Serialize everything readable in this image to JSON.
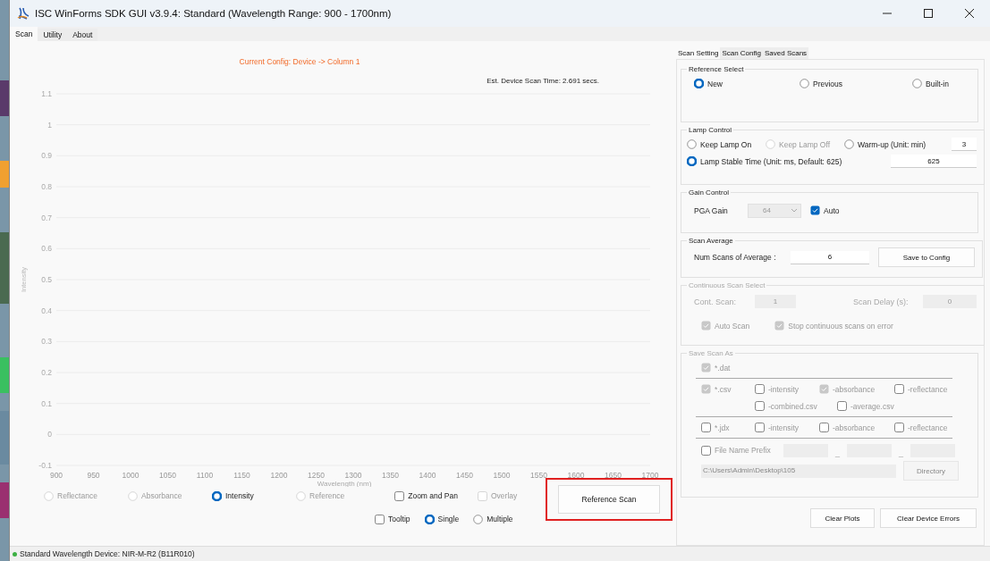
{
  "window": {
    "title": "ISC WinForms SDK GUI v3.9.4: Standard (Wavelength Range: 900 - 1700nm)"
  },
  "tabs": [
    {
      "label": "Scan",
      "selected": true
    },
    {
      "label": "Utility",
      "selected": false
    },
    {
      "label": "About",
      "selected": false
    }
  ],
  "plot": {
    "config_text": "Current Config: Device -> Column 1",
    "scan_time": "Est. Device Scan Time: 2.691 secs.",
    "chart_data": {
      "type": "line",
      "grid": true,
      "xlabel": "Wavelength (nm)",
      "ylabel": "Intensity",
      "xlim": [
        900,
        1700
      ],
      "ylim": [
        -0.1,
        1.1
      ],
      "xticks": [
        900,
        950,
        1000,
        1050,
        1100,
        1150,
        1200,
        1250,
        1300,
        1350,
        1400,
        1450,
        1500,
        1550,
        1600,
        1650,
        1700
      ],
      "yticks": [
        -0.1,
        0,
        0.1,
        0.2,
        0.3,
        0.4,
        0.5,
        0.6,
        0.7,
        0.8,
        0.9,
        1,
        1.1
      ]
    }
  },
  "plot_modes": [
    {
      "label": "Reflectance",
      "selected": false,
      "disabled": true
    },
    {
      "label": "Absorbance",
      "selected": false,
      "disabled": true
    },
    {
      "label": "Intensity",
      "selected": true,
      "disabled": false
    },
    {
      "label": "Reference",
      "selected": false,
      "disabled": true
    }
  ],
  "plot_options": [
    {
      "kind": "checkbox",
      "label": "Zoom and Pan",
      "checked": false,
      "disabled": false
    },
    {
      "kind": "checkbox",
      "label": "Overlay",
      "checked": false,
      "disabled": true
    }
  ],
  "view_options": [
    {
      "kind": "checkbox",
      "label": "Tooltip",
      "checked": false,
      "disabled": false
    },
    {
      "kind": "radio",
      "label": "Single",
      "selected": true,
      "disabled": false
    },
    {
      "kind": "radio",
      "label": "Multiple",
      "selected": false,
      "disabled": false
    }
  ],
  "reference_scan_button": {
    "label": "Reference Scan",
    "highlighted": true
  },
  "side_tabs": [
    {
      "label": "Scan Setting",
      "selected": true
    },
    {
      "label": "Scan Config",
      "selected": false
    },
    {
      "label": "Saved Scans",
      "selected": false
    }
  ],
  "reference_select": {
    "title": "Reference Select",
    "options": [
      {
        "label": "New",
        "selected": true
      },
      {
        "label": "Previous",
        "selected": false
      },
      {
        "label": "Built-in",
        "selected": false
      }
    ]
  },
  "lamp_control": {
    "title": "Lamp Control",
    "options": [
      {
        "label": "Keep Lamp On",
        "selected": false,
        "disabled": false
      },
      {
        "label": "Keep Lamp Off",
        "selected": false,
        "disabled": true
      },
      {
        "label": "Warm-up (Unit: min)",
        "selected": false,
        "disabled": false
      }
    ],
    "warmup_value": "3",
    "stable": {
      "label": "Lamp Stable Time  (Unit: ms, Default: 625)",
      "selected": true
    },
    "stable_value": "625"
  },
  "gain_control": {
    "title": "Gain Control",
    "label": "PGA Gain",
    "value": "64",
    "auto": {
      "label": "Auto",
      "checked": true
    }
  },
  "scan_average": {
    "title": "Scan Average",
    "label": "Num Scans of Average :",
    "value": "6",
    "button": "Save to Config"
  },
  "continuous_scan": {
    "title": "Continuous Scan Select",
    "disabled": true,
    "cont_label": "Cont. Scan:",
    "cont_value": "1",
    "delay_label": "Scan Delay (s):",
    "delay_value": "0",
    "checks": [
      {
        "label": "Auto Scan",
        "checked": true
      },
      {
        "label": "Stop continuous scans on error",
        "checked": true
      }
    ]
  },
  "save_scan_as": {
    "title": "Save Scan As",
    "disabled": true,
    "rows": [
      {
        "kind": "main",
        "items": [
          {
            "label": "*.dat",
            "checked": true
          }
        ]
      },
      {
        "kind": "main",
        "items": [
          {
            "label": "*.csv",
            "checked": true
          },
          {
            "label": "-intensity",
            "checked": false
          },
          {
            "label": "-absorbance",
            "checked": true
          },
          {
            "label": "-reflectance",
            "checked": false
          }
        ]
      },
      {
        "kind": "sub",
        "items": [
          {
            "label": "-combined.csv",
            "checked": false
          },
          {
            "label": "-average.csv",
            "checked": false
          }
        ]
      },
      {
        "kind": "main",
        "items": [
          {
            "label": "*.jdx",
            "checked": false
          },
          {
            "label": "-intensity",
            "checked": false
          },
          {
            "label": "-absorbance",
            "checked": false
          },
          {
            "label": "-reflectance",
            "checked": false
          }
        ]
      }
    ],
    "prefix": {
      "label": "File Name Prefix",
      "checked": false,
      "separators": [
        "_",
        "_"
      ]
    },
    "directory_path": "C:\\Users\\Admin\\Desktop\\105",
    "directory_button": "Directory"
  },
  "bottom_buttons": [
    "Clear Plots",
    "Clear Device Errors"
  ],
  "status_bar": {
    "text": "Standard Wavelength Device: NIR-M-R2 (B11R010)",
    "connected": true
  }
}
